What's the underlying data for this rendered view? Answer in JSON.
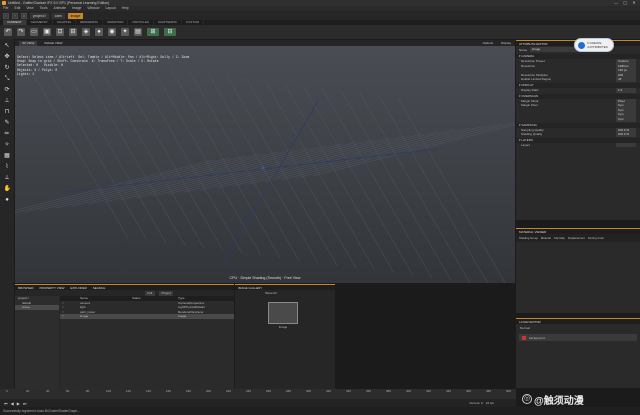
{
  "window": {
    "title": "Untitled - Gaffer/Clarisse iFX 5.0 SP1 (Personal Learning Edition)",
    "min": "—",
    "max": "▢",
    "close": "✕"
  },
  "menu": [
    "File",
    "Edit",
    "View",
    "Tools",
    "Animate",
    "Image",
    "Window",
    "Layout",
    "Help"
  ],
  "breadcrumb": {
    "root": "project:/",
    "mid": "cam",
    "current": "image"
  },
  "workspace_tabs": [
    "CURRENT",
    "GEOMETRY",
    "LIGHTING",
    "RENDERING",
    "ANIMATION",
    "PARTICLES",
    "SCATTERING",
    "CUSTOM"
  ],
  "viewport": {
    "tabs": [
      "3D VIEW",
      "IMAGE VIEW"
    ],
    "options": [
      "Options",
      "Display"
    ],
    "info_lines": [
      "Select: Select item / Alt+Left  Sel: Tumble / Alt+Middle: Pan / Alt+Right: Dolly / Z: Zoom",
      "Snap: Snap to grid / Shift: Constrain  X: Transform / T: Scale / E: Rotate",
      "Selected: 0   Visible: 0",
      "Objects: 3 / Polys: 0",
      "Lights: 1"
    ],
    "label": "CPU · Simple Shading (Smooth) · Free View"
  },
  "attr_editor": {
    "title": "ATTRIBUTE EDITOR",
    "name_label": "Name",
    "name_value": "image",
    "sections": [
      {
        "title": "CAMERA",
        "rows": [
          {
            "k": "Resolution Preset",
            "v": "Custom"
          },
          {
            "k": "Resolution",
            "v": "1280 px"
          },
          {
            "k": "",
            "v": "720 px"
          },
          {
            "k": "Resolution Multiplier",
            "v": "100"
          },
          {
            "k": "Enable Limited Region",
            "v": "off"
          }
        ]
      },
      {
        "title": "DISPLAY",
        "rows": [
          {
            "k": "Display Ratio",
            "v": "1.0"
          }
        ]
      },
      {
        "title": "OVERSCAN",
        "rows": [
          {
            "k": "Margin Mode",
            "v": "Pixel"
          },
          {
            "k": "Margin Pixel",
            "v": "0 px"
          },
          {
            "k": "",
            "v": "0 px"
          },
          {
            "k": "",
            "v": "0 px"
          },
          {
            "k": "",
            "v": "0 px"
          }
        ]
      },
      {
        "title": "SAMPLING",
        "rows": [
          {
            "k": "Sampling Quality",
            "v": "100.0 %"
          },
          {
            "k": "Shading Quality",
            "v": "100.0 %"
          }
        ]
      },
      {
        "title": "LAYERS",
        "rows": [
          {
            "k": "Layers",
            "v": ""
          }
        ]
      }
    ]
  },
  "badge": {
    "line1": "3 CREATE",
    "line2": "4 ATTRIBUTES"
  },
  "material_editor": {
    "title": "MATERIAL VIEWER",
    "cols": [
      "Shading Group",
      "Material",
      "Clip Map",
      "Displacement",
      "Sorting Color"
    ]
  },
  "layer_editor": {
    "title": "LAYER EDITOR",
    "filter": "Normal",
    "layer": "background"
  },
  "browser": {
    "tabs": [
      "BROWSER",
      "PROPERTY VIEW",
      "EXPLORER",
      "SEARCH"
    ],
    "tree": [
      "project:/",
      "default",
      "scene"
    ],
    "table_headers": [
      "",
      "Name",
      "Status",
      "Type"
    ],
    "rows": [
      {
        "name": "camera",
        "status": "",
        "type": "CameraPerspective"
      },
      {
        "name": "light",
        "status": "",
        "type": "LightPhysicalDistant"
      },
      {
        "name": "path_tracer",
        "status": "",
        "type": "RendererRaytracer"
      },
      {
        "name": "image",
        "status": "",
        "type": "Image"
      }
    ],
    "buttons": [
      "Cell View",
      "Project Item"
    ]
  },
  "gallery": {
    "title": "IMAGE GALLERY",
    "item": "Image",
    "filter": "Show All"
  },
  "timeline": {
    "ticks": [
      "0",
      "10",
      "20",
      "30",
      "40",
      "50",
      "60",
      "70",
      "80",
      "90",
      "100",
      "110",
      "120",
      "130",
      "140",
      "150",
      "160",
      "170",
      "180",
      "190",
      "200",
      "210",
      "220",
      "230",
      "240",
      "250",
      "260",
      "270",
      "280",
      "290",
      "300",
      "310",
      "320",
      "330",
      "340",
      "350",
      "360",
      "370",
      "380",
      "390",
      "400",
      "410",
      "420",
      "430",
      "440",
      "450",
      "460",
      "470",
      "480",
      "490",
      "500"
    ],
    "frame": "Current: 0",
    "fps": "24 fps"
  },
  "status": "Successfully registered class libClusterShaderGraph...",
  "watermark": "@触须动漫"
}
